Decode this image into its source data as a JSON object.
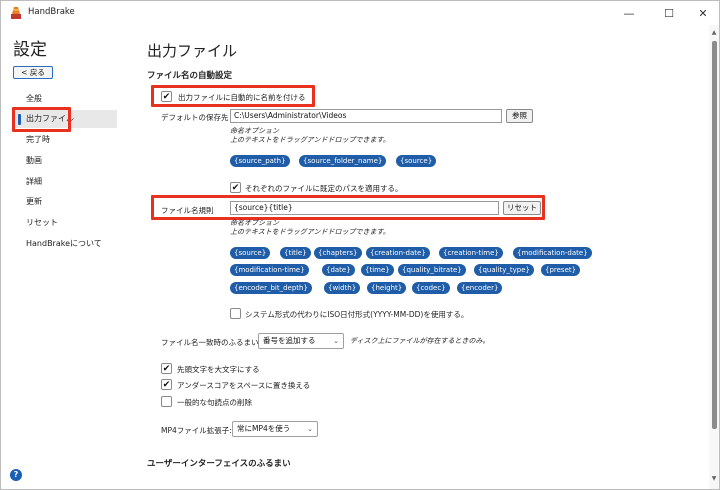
{
  "window": {
    "title": "HandBrake",
    "minimize_glyph": "—",
    "maximize_glyph": "☐",
    "close_glyph": "✕"
  },
  "sidebar": {
    "title": "設定",
    "back_label": "< 戻る",
    "items": [
      {
        "label": "全般"
      },
      {
        "label": "出力ファイル"
      },
      {
        "label": "完了時"
      },
      {
        "label": "動画"
      },
      {
        "label": "詳細"
      },
      {
        "label": "更新"
      },
      {
        "label": "リセット"
      },
      {
        "label": "HandBrakeについて"
      }
    ],
    "active_index": 1,
    "help_glyph": "?"
  },
  "main": {
    "page_title": "出力ファイル",
    "section_auto_naming": "ファイル名の自動設定",
    "auto_name_checkbox": {
      "label": "出力ファイルに自動的に名前を付ける",
      "checked": true
    },
    "default_path": {
      "label": "デフォルトの保存先",
      "value": "C:\\Users\\Administrator\\Videos",
      "browse_label": "参照"
    },
    "path_hint": [
      "命名オプション",
      "上のテキストをドラッグアンドドロップできます。"
    ],
    "path_tokens": [
      "{source_path}",
      "{source_folder_name}",
      "{source}"
    ],
    "apply_path_checkbox": {
      "label": "それぞれのファイルに既定のパスを適用する。",
      "checked": true
    },
    "file_format": {
      "label": "ファイル名規則",
      "value": "{source}{title}",
      "reset_label": "リセット"
    },
    "format_hint": [
      "命名オプション",
      "上のテキストをドラッグアンドドロップできます。"
    ],
    "format_tokens": [
      [
        "{source}",
        "{title}",
        "{chapters}",
        "{creation-date}",
        "{creation-time}",
        "{modification-date}"
      ],
      [
        "{modification-time}",
        "{date}",
        "{time}",
        "{quality_bitrate}",
        "{quality_type}",
        "{preset}"
      ],
      [
        "{encoder_bit_depth}",
        "{width}",
        "{height}",
        "{codec}",
        "{encoder}"
      ]
    ],
    "iso_date_checkbox": {
      "label": "システム形式の代わりにISO日付形式(YYYY-MM-DD)を使用する。",
      "checked": false
    },
    "collision": {
      "label": "ファイル名一致時のふるまい:",
      "selected": "番号を追加する",
      "suffix": "ディスク上にファイルが存在するときのみ。"
    },
    "capitalize_checkbox": {
      "label": "先頭文字を大文字にする",
      "checked": true
    },
    "underscore_checkbox": {
      "label": "アンダースコアをスペースに置き換える",
      "checked": true
    },
    "punctuation_checkbox": {
      "label": "一般的な句読点の削除",
      "checked": false
    },
    "mp4_ext": {
      "label": "MP4ファイル拡張子:",
      "selected": "常にMP4を使う"
    },
    "section_ui": "ユーザーインターフェイスのふるまい"
  },
  "colors": {
    "accent": "#1a5fb4",
    "token_bg": "#1f5da8",
    "highlight_border": "#e8321f"
  }
}
